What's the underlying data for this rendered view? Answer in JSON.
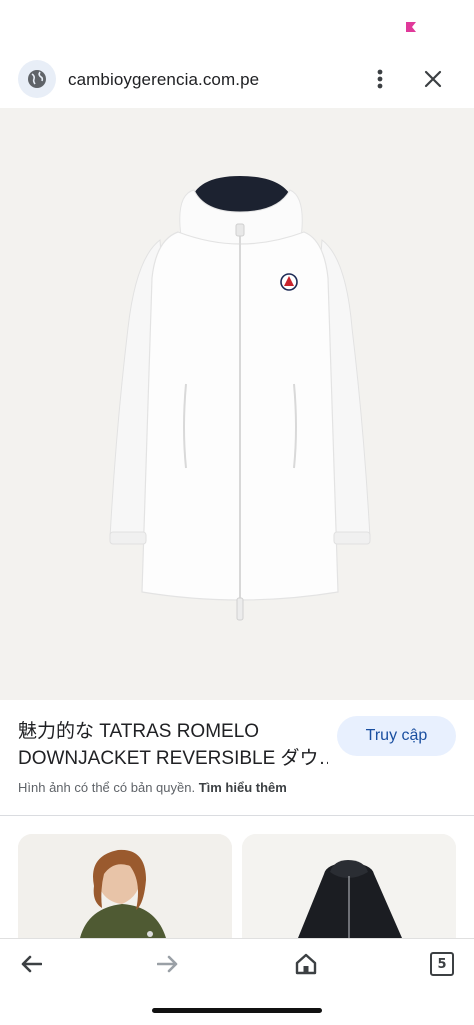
{
  "browser": {
    "url": "cambioygerencia.com.pe"
  },
  "result": {
    "title_line1": "魅力的な TATRAS ROMELO",
    "title_line2": "DOWNJACKET REVERSIBLE ダウ…",
    "visit_label": "Truy cập",
    "copyright_text": "Hình ảnh có thể có bản quyền.",
    "learn_more_label": "Tìm hiểu thêm"
  },
  "bottom_nav": {
    "tab_count": "5"
  },
  "icons": {
    "site": "globe-icon",
    "more": "more-vert-icon",
    "close": "close-icon",
    "back": "back-arrow-icon",
    "forward": "forward-arrow-icon",
    "home": "home-icon",
    "tabs": "tab-switcher-icon"
  },
  "colors": {
    "accent_button_bg": "#e8f0fe",
    "accent_button_text": "#1a4fa0",
    "image_background": "#f3f2ef",
    "status_mark": "#e0399a"
  }
}
